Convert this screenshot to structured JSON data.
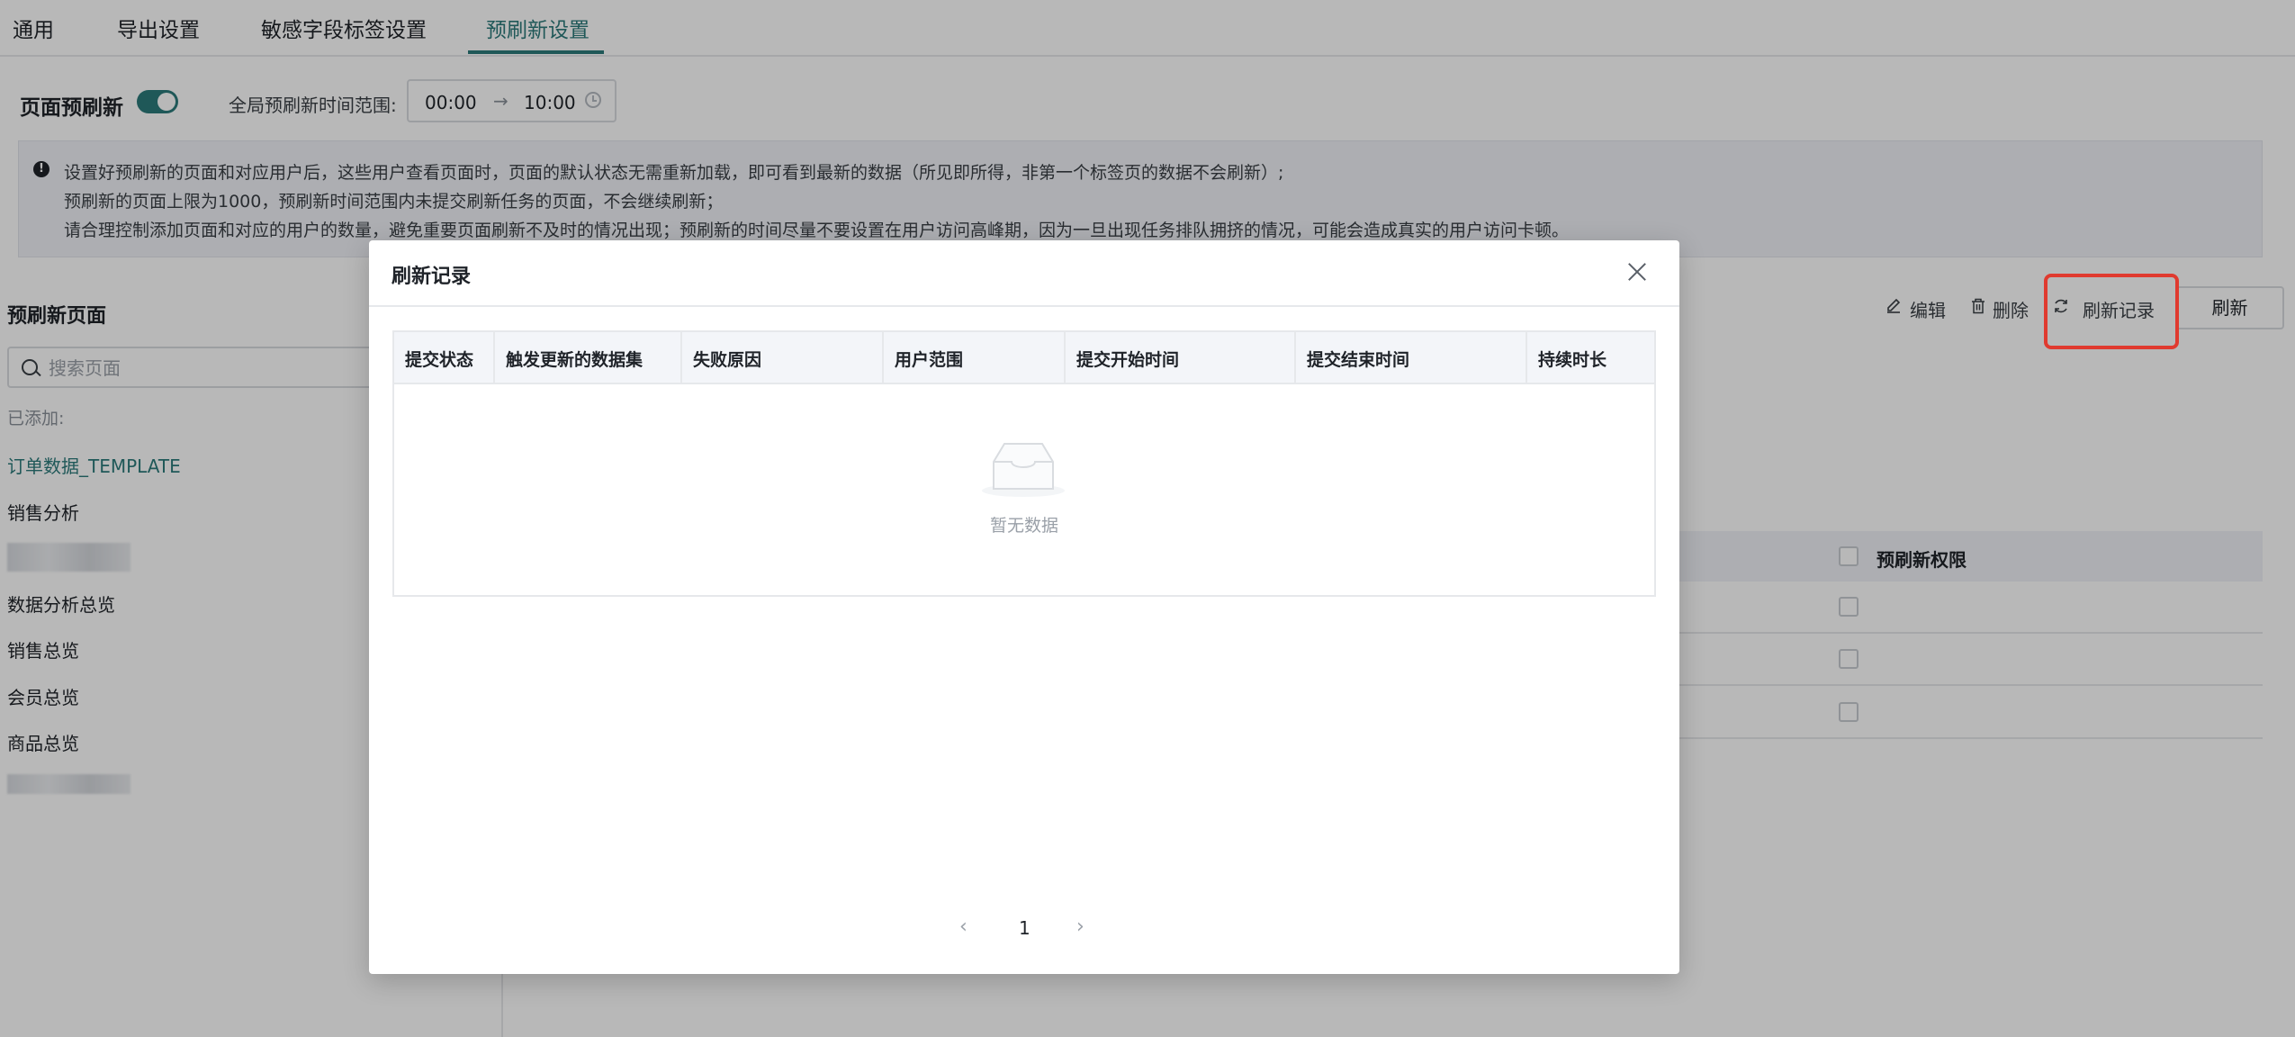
{
  "tabs": [
    {
      "label": "通用"
    },
    {
      "label": "导出设置"
    },
    {
      "label": "敏感字段标签设置"
    },
    {
      "label": "预刷新设置"
    }
  ],
  "settings": {
    "prerefresh_label": "页面预刷新",
    "toggle_on": true,
    "range_label": "全局预刷新时间范围:",
    "range_start": "00:00",
    "range_arrow": "→",
    "range_end": "10:00"
  },
  "notice": {
    "lines": [
      "设置好预刷新的页面和对应用户后，这些用户查看页面时，页面的默认状态无需重新加载，即可看到最新的数据（所见即所得，非第一个标签页的数据不会刷新）;",
      "预刷新的页面上限为1000，预刷新时间范围内未提交刷新任务的页面，不会继续刷新；",
      "请合理控制添加页面和对应的用户的数量，避免重要页面刷新不及时的情况出现；预刷新的时间尽量不要设置在用户访问高峰期，因为一旦出现任务排队拥挤的情况，可能会造成真实的用户访问卡顿。"
    ]
  },
  "left": {
    "title": "预刷新页面",
    "search_placeholder": "搜索页面",
    "added_label": "已添加:",
    "items": [
      {
        "label": "订单数据_TEMPLATE"
      },
      {
        "label": "销售分析"
      },
      {
        "label": "数据分析总览"
      },
      {
        "label": "销售总览"
      },
      {
        "label": "会员总览"
      },
      {
        "label": "商品总览"
      }
    ]
  },
  "toolbar": {
    "edit": "编辑",
    "delete": "删除",
    "records": "刷新记录",
    "refresh": "刷新"
  },
  "bg_table": {
    "column": "预刷新权限"
  },
  "modal": {
    "title": "刷新记录",
    "columns": [
      "提交状态",
      "触发更新的数据集",
      "失败原因",
      "用户范围",
      "提交开始时间",
      "提交结束时间",
      "持续时长"
    ],
    "empty_text": "暂无数据",
    "page": "1",
    "prev": "‹",
    "next": "›"
  }
}
